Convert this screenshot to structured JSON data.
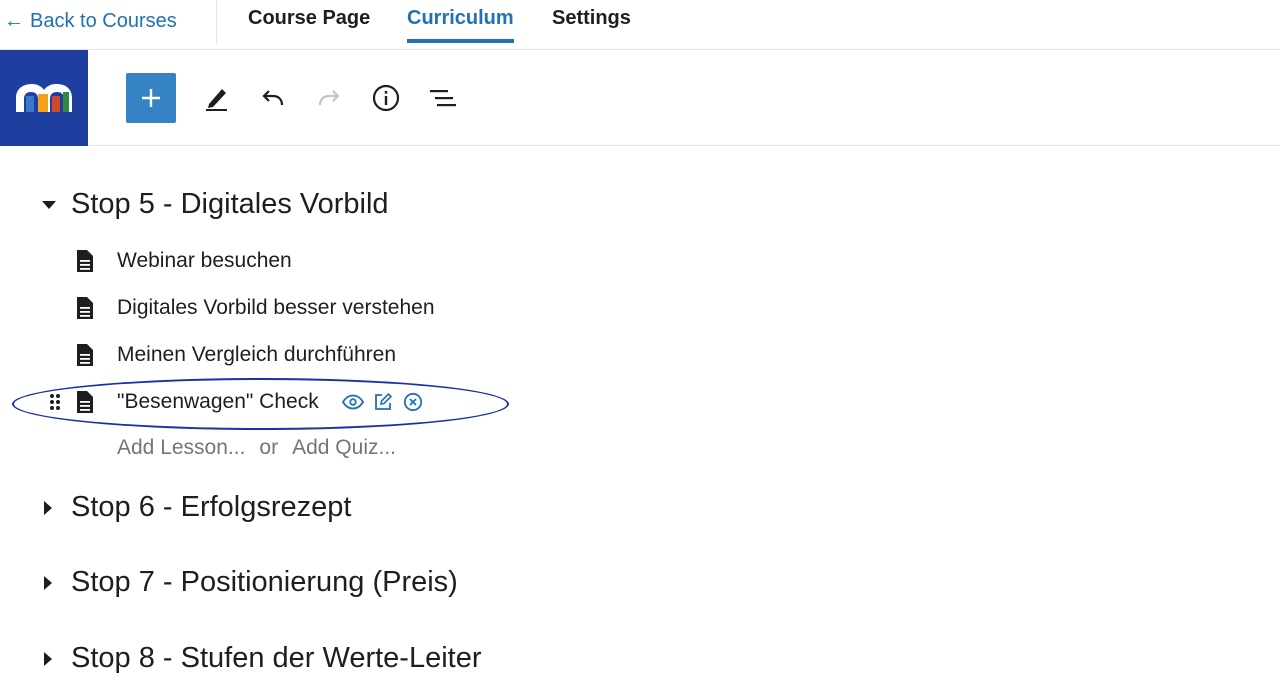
{
  "nav": {
    "back_label": "Back to Courses",
    "back_arrow": "←",
    "tabs": [
      {
        "label": "Course Page",
        "active": false
      },
      {
        "label": "Curriculum",
        "active": true
      },
      {
        "label": "Settings",
        "active": false
      }
    ]
  },
  "toolbar": {
    "logo_icon": "moodle-logo-icon",
    "tools": [
      "add-block-icon",
      "pencil-icon",
      "undo-icon",
      "redo-icon",
      "info-icon",
      "list-view-icon"
    ]
  },
  "colors": {
    "accent": "#2271b1",
    "add_button": "#3582c4",
    "logo_bg": "#1e3fa0",
    "highlight": "#1a2fa8"
  },
  "curriculum": {
    "sections": [
      {
        "title": "Stop 5 - Digitales Vorbild",
        "expanded": true
      },
      {
        "title": "Stop 6 - Erfolgsrezept",
        "expanded": false
      },
      {
        "title": "Stop 7 - Positionierung (Preis)",
        "expanded": false
      },
      {
        "title": "Stop 8 - Stufen der Werte-Leiter",
        "expanded": false
      }
    ],
    "lessons": [
      {
        "label": "Webinar besuchen"
      },
      {
        "label": "Digitales Vorbild besser verstehen"
      },
      {
        "label": "Meinen Vergleich durchführen"
      },
      {
        "label": "\"Besenwagen\" Check"
      }
    ],
    "add_lesson": "Add Lesson...",
    "or": "or",
    "add_quiz": "Add Quiz..."
  }
}
